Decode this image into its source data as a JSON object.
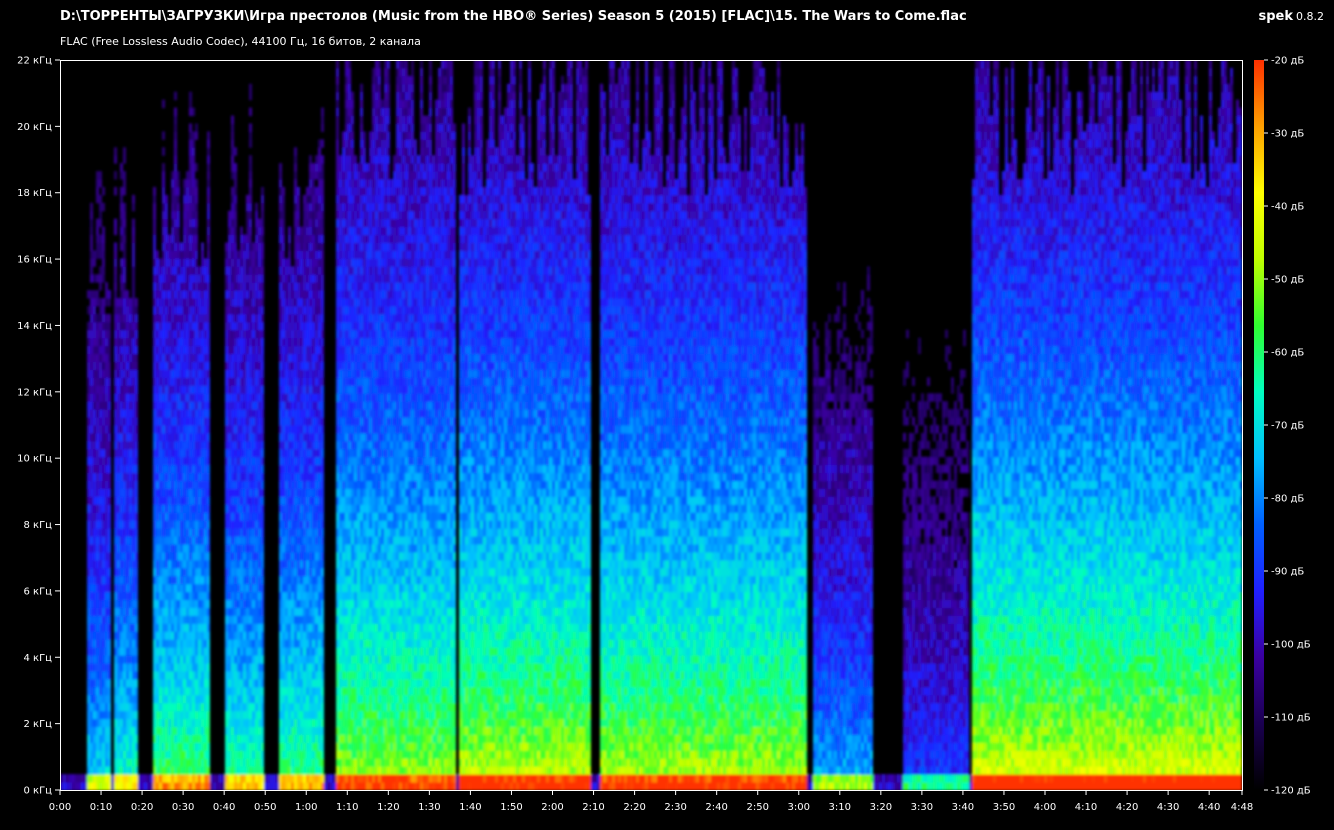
{
  "header": {
    "file_path": "D:\\ТОРРЕНТЫ\\ЗАГРУЗКИ\\Игра престолов (Music from the HBO® Series) Season 5 (2015) [FLAC]\\15. The Wars to Come.flac",
    "format_info": "FLAC (Free Lossless Audio Codec), 44100 Гц, 16 битов, 2 канала",
    "app_name": "spek",
    "app_version": "0.8.2"
  },
  "chart_data": {
    "type": "heatmap",
    "x_unit": "time (m:ss)",
    "x_range_seconds": [
      0,
      288
    ],
    "x_ticks": [
      "0:00",
      "0:10",
      "0:20",
      "0:30",
      "0:40",
      "0:50",
      "1:00",
      "1:10",
      "1:20",
      "1:30",
      "1:40",
      "1:50",
      "2:00",
      "2:10",
      "2:20",
      "2:30",
      "2:40",
      "2:50",
      "3:00",
      "3:10",
      "3:20",
      "3:30",
      "3:40",
      "3:50",
      "4:00",
      "4:10",
      "4:20",
      "4:30",
      "4:40",
      "4:48"
    ],
    "y_range_khz": [
      0,
      22
    ],
    "y_ticks": [
      "0 кГц",
      "2 кГц",
      "4 кГц",
      "6 кГц",
      "8 кГц",
      "10 кГц",
      "12 кГц",
      "14 кГц",
      "16 кГц",
      "18 кГц",
      "20 кГц",
      "22 кГц"
    ],
    "colorbar_range_db": [
      -120,
      -20
    ],
    "colorbar_ticks": [
      "-20 дБ",
      "-30 дБ",
      "-40 дБ",
      "-50 дБ",
      "-60 дБ",
      "-70 дБ",
      "-80 дБ",
      "-90 дБ",
      "-100 дБ",
      "-110 дБ",
      "-120 дБ"
    ],
    "colormap": [
      "#000000",
      "#1a0050",
      "#3a00a0",
      "#2020ff",
      "#0060ff",
      "#00c0ff",
      "#00ffc0",
      "#30ff30",
      "#c0ff00",
      "#ffff00",
      "#ffa000",
      "#ff3000"
    ],
    "sections": [
      {
        "start_s": 6,
        "end_s": 12,
        "max_khz": 16.5,
        "level": 0.55
      },
      {
        "start_s": 13,
        "end_s": 19,
        "max_khz": 17,
        "level": 0.62
      },
      {
        "start_s": 22,
        "end_s": 36,
        "max_khz": 18.5,
        "level": 0.7
      },
      {
        "start_s": 40,
        "end_s": 49,
        "max_khz": 18.5,
        "level": 0.65
      },
      {
        "start_s": 53,
        "end_s": 64,
        "max_khz": 18.5,
        "level": 0.68
      },
      {
        "start_s": 67,
        "end_s": 96,
        "max_khz": 21,
        "level": 0.78
      },
      {
        "start_s": 97,
        "end_s": 129,
        "max_khz": 21,
        "level": 0.82
      },
      {
        "start_s": 131,
        "end_s": 182,
        "max_khz": 21,
        "level": 0.8
      },
      {
        "start_s": 183,
        "end_s": 198,
        "max_khz": 14,
        "level": 0.5
      },
      {
        "start_s": 205,
        "end_s": 221,
        "max_khz": 13,
        "level": 0.35
      },
      {
        "start_s": 222,
        "end_s": 288,
        "max_khz": 21,
        "level": 0.85
      }
    ]
  }
}
